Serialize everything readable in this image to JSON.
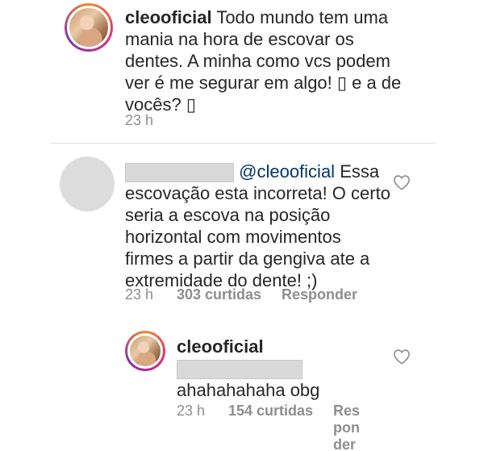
{
  "post": {
    "username": "cleooficial",
    "caption_lines": [
      "Todo mundo tem uma",
      "mania na hora de escovar os",
      "dentes. A minha como vcs podem",
      "ver é me segurar em algo! ▯ e a de",
      "vocês? ▯"
    ],
    "time": "23 h"
  },
  "comment1": {
    "mention": "@cleooficial",
    "text_lines": [
      "Essa",
      "escovação esta incorreta! O certo",
      "seria a escova na posição",
      "horizontal com movimentos",
      "firmes a partir da gengiva ate a",
      "extremidade do dente! ;)"
    ],
    "time": "23 h",
    "likes": "303 curtidas",
    "reply_label": "Responder"
  },
  "reply1": {
    "username": "cleooficial",
    "text": "ahahahahaha obg",
    "time": "23 h",
    "likes": "154 curtidas",
    "reply_label_lines": [
      "Res",
      "pon",
      "der"
    ]
  },
  "colors": {
    "text": "#262626",
    "muted": "#8e8e8e",
    "mention": "#003569",
    "redaction": "#d9d9d9"
  },
  "icons": {
    "like": "heart-outline-icon"
  }
}
